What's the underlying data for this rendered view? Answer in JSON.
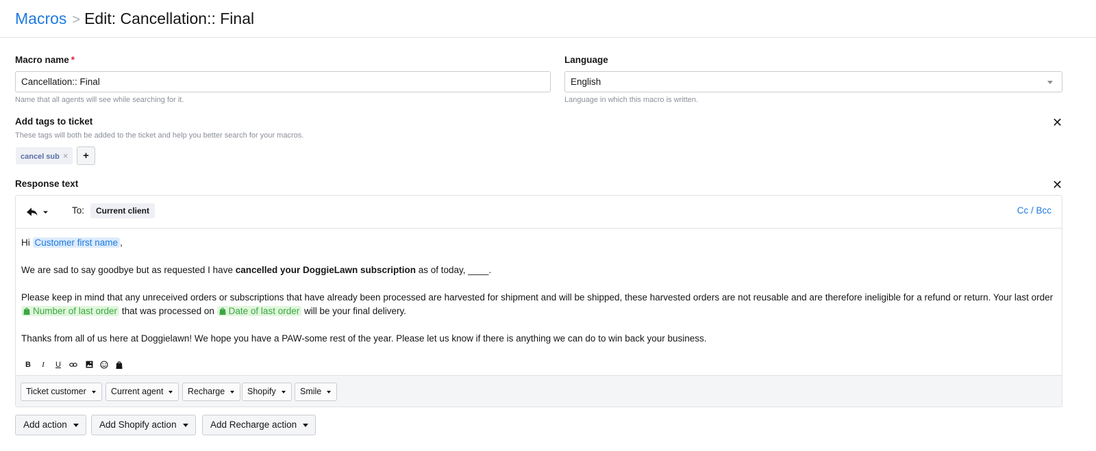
{
  "breadcrumb": {
    "root": "Macros",
    "separator": ">",
    "current": "Edit: Cancellation:: Final"
  },
  "macro_name": {
    "label": "Macro name",
    "required_mark": "*",
    "value": "Cancellation:: Final",
    "help": "Name that all agents will see while searching for it."
  },
  "language": {
    "label": "Language",
    "value": "English",
    "help": "Language in which this macro is written."
  },
  "tags": {
    "label": "Add tags to ticket",
    "help": "These tags will both be added to the ticket and help you better search for your macros.",
    "items": [
      {
        "label": "cancel sub",
        "remove": "×"
      }
    ],
    "add_label": "+",
    "close": "✕"
  },
  "response": {
    "label": "Response text",
    "close": "✕",
    "to_label": "To:",
    "recipient": "Current client",
    "cc_bcc": "Cc / Bcc",
    "greeting": "Hi",
    "customer_var": "Customer first name",
    "greeting_end": ",",
    "p1_start": "We are sad to say goodbye but as requested I have ",
    "p1_bold": "cancelled your DoggieLawn subscription",
    "p1_end": " as of today, ____.",
    "p2_start": "Please keep in mind that any unreceived orders or subscriptions that have already been processed are harvested for shipment and will be shipped, these harvested orders are not reusable and are therefore ineligible for a refund or return.  Your last order ",
    "order_var": "Number of last order",
    "p2_mid": " that was processed on ",
    "date_var": "Date of last order",
    "p2_end": " will be your final delivery.",
    "p3": "Thanks from all of us here at Doggielawn! We hope you have a PAW-some rest of the year. Please let us know if there is anything we can do to win back your business."
  },
  "format_toolbar": {
    "bold": "B",
    "italic": "I",
    "underline": "U",
    "icons": [
      "link-icon",
      "image-icon",
      "emoji-icon",
      "shopify-icon"
    ]
  },
  "variable_dropdowns": [
    "Ticket customer",
    "Current agent",
    "Recharge",
    "Shopify",
    "Smile"
  ],
  "actions": [
    "Add action",
    "Add Shopify action",
    "Add Recharge action"
  ],
  "colors": {
    "link": "#1f7ae0",
    "required": "#e01e3c",
    "variable_green": "#3aa745",
    "variable_green_bg": "#e1f7dc",
    "variable_blue_bg": "#dcebfc"
  }
}
